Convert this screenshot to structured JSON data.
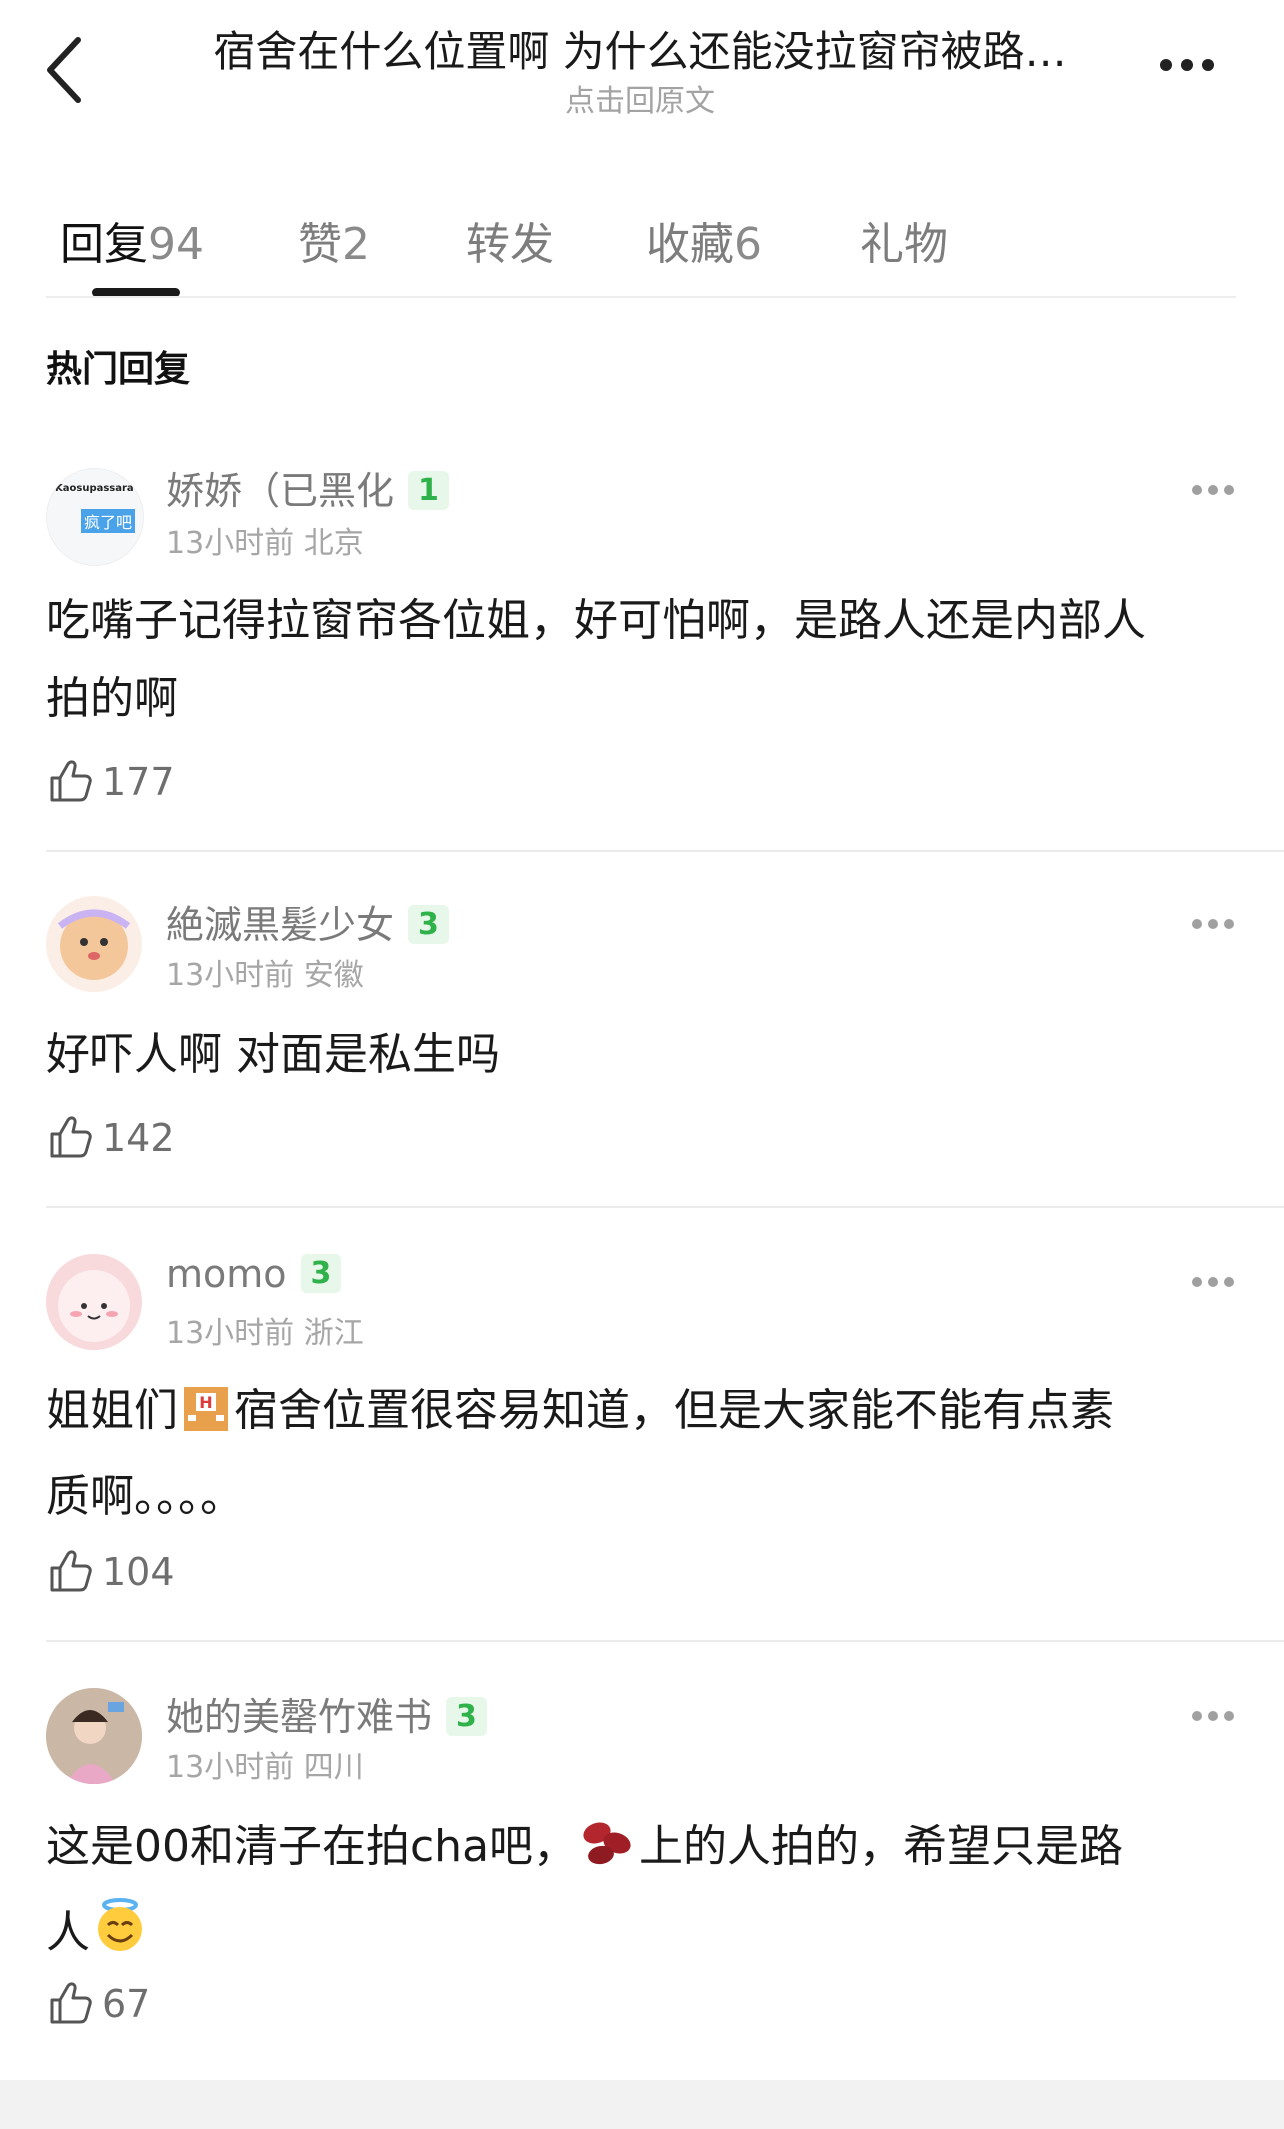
{
  "header": {
    "title": "宿舍在什么位置啊 为什么还能没拉窗帘被路…",
    "subtitle": "点击回原文"
  },
  "tabs": [
    {
      "label": "回复",
      "count": "94"
    },
    {
      "label": "赞",
      "count": "2"
    },
    {
      "label": "转发",
      "count": ""
    },
    {
      "label": "收藏",
      "count": "6"
    },
    {
      "label": "礼物",
      "count": ""
    }
  ],
  "section_title": "热门回复",
  "comments": [
    {
      "username": "娇娇（已黑化",
      "level": "1",
      "time": "13小时前",
      "location": "北京",
      "text1": "吃嘴子记得拉窗帘各位姐，好可怕啊，是路人还是内部人",
      "text2": "拍的啊",
      "likes": "177",
      "avatar_text1": "Kaosupassara",
      "avatar_text2": "疯了吧"
    },
    {
      "username": "絶滅黒髪少女",
      "level": "3",
      "time": "13小时前",
      "location": "安徽",
      "text1": "好吓人啊 对面是私生吗",
      "likes": "142"
    },
    {
      "username": "momo",
      "level": "3",
      "time": "13小时前",
      "location": "浙江",
      "text1a": "姐姐们",
      "text1b": "宿舍位置很容易知道，但是大家能不能有点素",
      "text2": "质啊。。。。",
      "likes": "104"
    },
    {
      "username": "她的美罄竹难书",
      "level": "3",
      "time": "13小时前",
      "location": "四川",
      "text1a": "这是00和清子在拍cha吧，",
      "text1b": "上的人拍的，希望只是路",
      "text2": "人",
      "likes": "67"
    }
  ],
  "icons": {
    "back": "chevron-left-icon",
    "more": "more-dots-icon",
    "like": "thumbs-up-icon",
    "hotel": "hotel-emoji",
    "beans": "beans-emoji",
    "halo": "halo-smile-emoji"
  },
  "colors": {
    "level_badge": "#2fb24a",
    "level_bg": "#e7f7e9"
  }
}
